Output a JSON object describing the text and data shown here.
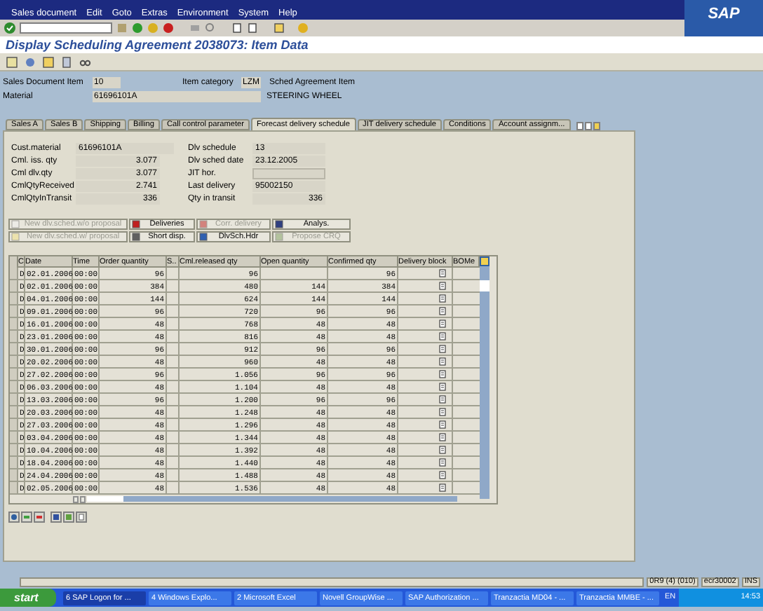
{
  "logo": "SAP",
  "menu": [
    "Sales document",
    "Edit",
    "Goto",
    "Extras",
    "Environment",
    "System",
    "Help"
  ],
  "page_title": "Display Scheduling Agreement 2038073: Item Data",
  "header": {
    "sales_document_item": {
      "label": "Sales Document Item",
      "value": "10"
    },
    "item_category": {
      "label": "Item category",
      "value": "LZM",
      "description": "Sched Agreement Item"
    },
    "material": {
      "label": "Material",
      "value": "61696101A",
      "description": "STEERING WHEEL"
    }
  },
  "tabs": [
    {
      "label": "Sales A",
      "selected": false
    },
    {
      "label": "Sales B",
      "selected": false
    },
    {
      "label": "Shipping",
      "selected": false
    },
    {
      "label": "Billing",
      "selected": false
    },
    {
      "label": "Call control parameter",
      "selected": false
    },
    {
      "label": "Forecast delivery schedule",
      "selected": true
    },
    {
      "label": "JIT delivery schedule",
      "selected": false
    },
    {
      "label": "Conditions",
      "selected": false
    },
    {
      "label": "Account assignm...",
      "selected": false
    }
  ],
  "fields_left": [
    {
      "label": "Cust.material",
      "value": "61696101A",
      "kind": "text"
    },
    {
      "label": "Cml. iss. qty",
      "value": "3.077",
      "kind": "number"
    },
    {
      "label": "Cml dlv.qty",
      "value": "3.077",
      "kind": "number"
    },
    {
      "label": "CmlQtyReceived",
      "value": "2.741",
      "kind": "number"
    },
    {
      "label": "CmlQtyInTransit",
      "value": "336",
      "kind": "number"
    }
  ],
  "fields_right": [
    {
      "label": "Dlv schedule",
      "value": "13",
      "kind": "text"
    },
    {
      "label": "Dlv sched date",
      "value": "23.12.2005",
      "kind": "text"
    },
    {
      "label": "JIT hor."
    },
    {
      "label": "Last delivery",
      "value": "95002150",
      "kind": "text"
    },
    {
      "label": "Qty in transit",
      "value": "336",
      "kind": "number"
    }
  ],
  "buttons": [
    {
      "label": "New dlv.sched.w/o proposal",
      "disabled": true
    },
    {
      "label": "Deliveries",
      "disabled": false
    },
    {
      "label": "Corr. delivery",
      "disabled": true
    },
    {
      "label": "Analys.",
      "disabled": false
    },
    {
      "label": "New dlv.sched.w/ proposal",
      "disabled": true
    },
    {
      "label": "Short disp.",
      "disabled": false
    },
    {
      "label": "DlvSch.Hdr",
      "disabled": false
    },
    {
      "label": "Propose CRQ",
      "disabled": true
    }
  ],
  "table": {
    "columns": [
      "C",
      "Date",
      "Time",
      "Order quantity",
      "S..",
      "Cml.released qty",
      "Open quantity",
      "Confirmed qty",
      "Delivery block",
      "BOMe"
    ],
    "rows": [
      [
        "D",
        "02.01.2006",
        "00:00",
        "96",
        "",
        "96",
        "",
        "96"
      ],
      [
        "D",
        "02.01.2006",
        "00:00",
        "384",
        "",
        "480",
        "144",
        "384"
      ],
      [
        "D",
        "04.01.2006",
        "00:00",
        "144",
        "",
        "624",
        "144",
        "144"
      ],
      [
        "D",
        "09.01.2006",
        "00:00",
        "96",
        "",
        "720",
        "96",
        "96"
      ],
      [
        "D",
        "16.01.2006",
        "00:00",
        "48",
        "",
        "768",
        "48",
        "48"
      ],
      [
        "D",
        "23.01.2006",
        "00:00",
        "48",
        "",
        "816",
        "48",
        "48"
      ],
      [
        "D",
        "30.01.2006",
        "00:00",
        "96",
        "",
        "912",
        "96",
        "96"
      ],
      [
        "D",
        "20.02.2006",
        "00:00",
        "48",
        "",
        "960",
        "48",
        "48"
      ],
      [
        "D",
        "27.02.2006",
        "00:00",
        "96",
        "",
        "1.056",
        "96",
        "96"
      ],
      [
        "D",
        "06.03.2006",
        "00:00",
        "48",
        "",
        "1.104",
        "48",
        "48"
      ],
      [
        "D",
        "13.03.2006",
        "00:00",
        "96",
        "",
        "1.200",
        "96",
        "96"
      ],
      [
        "D",
        "20.03.2006",
        "00:00",
        "48",
        "",
        "1.248",
        "48",
        "48"
      ],
      [
        "D",
        "27.03.2006",
        "00:00",
        "48",
        "",
        "1.296",
        "48",
        "48"
      ],
      [
        "D",
        "03.04.2006",
        "00:00",
        "48",
        "",
        "1.344",
        "48",
        "48"
      ],
      [
        "D",
        "10.04.2006",
        "00:00",
        "48",
        "",
        "1.392",
        "48",
        "48"
      ],
      [
        "D",
        "18.04.2006",
        "00:00",
        "48",
        "",
        "1.440",
        "48",
        "48"
      ],
      [
        "D",
        "24.04.2006",
        "00:00",
        "48",
        "",
        "1.488",
        "48",
        "48"
      ],
      [
        "D",
        "02.05.2006",
        "00:00",
        "48",
        "",
        "1.536",
        "48",
        "48"
      ]
    ]
  },
  "status_bar": {
    "system": "0R9 (4) (010)",
    "server": "ecr30002",
    "mode": "INS"
  },
  "taskbar": {
    "start": "start",
    "items": [
      "6 SAP Logon for ...",
      "4 Windows Explo...",
      "2 Microsoft Excel",
      "Novell GroupWise ...",
      "SAP Authorization ...",
      "Tranzactia MD04 - ...",
      "Tranzactia MMBE - ..."
    ],
    "language": "EN",
    "clock": "14:53"
  }
}
